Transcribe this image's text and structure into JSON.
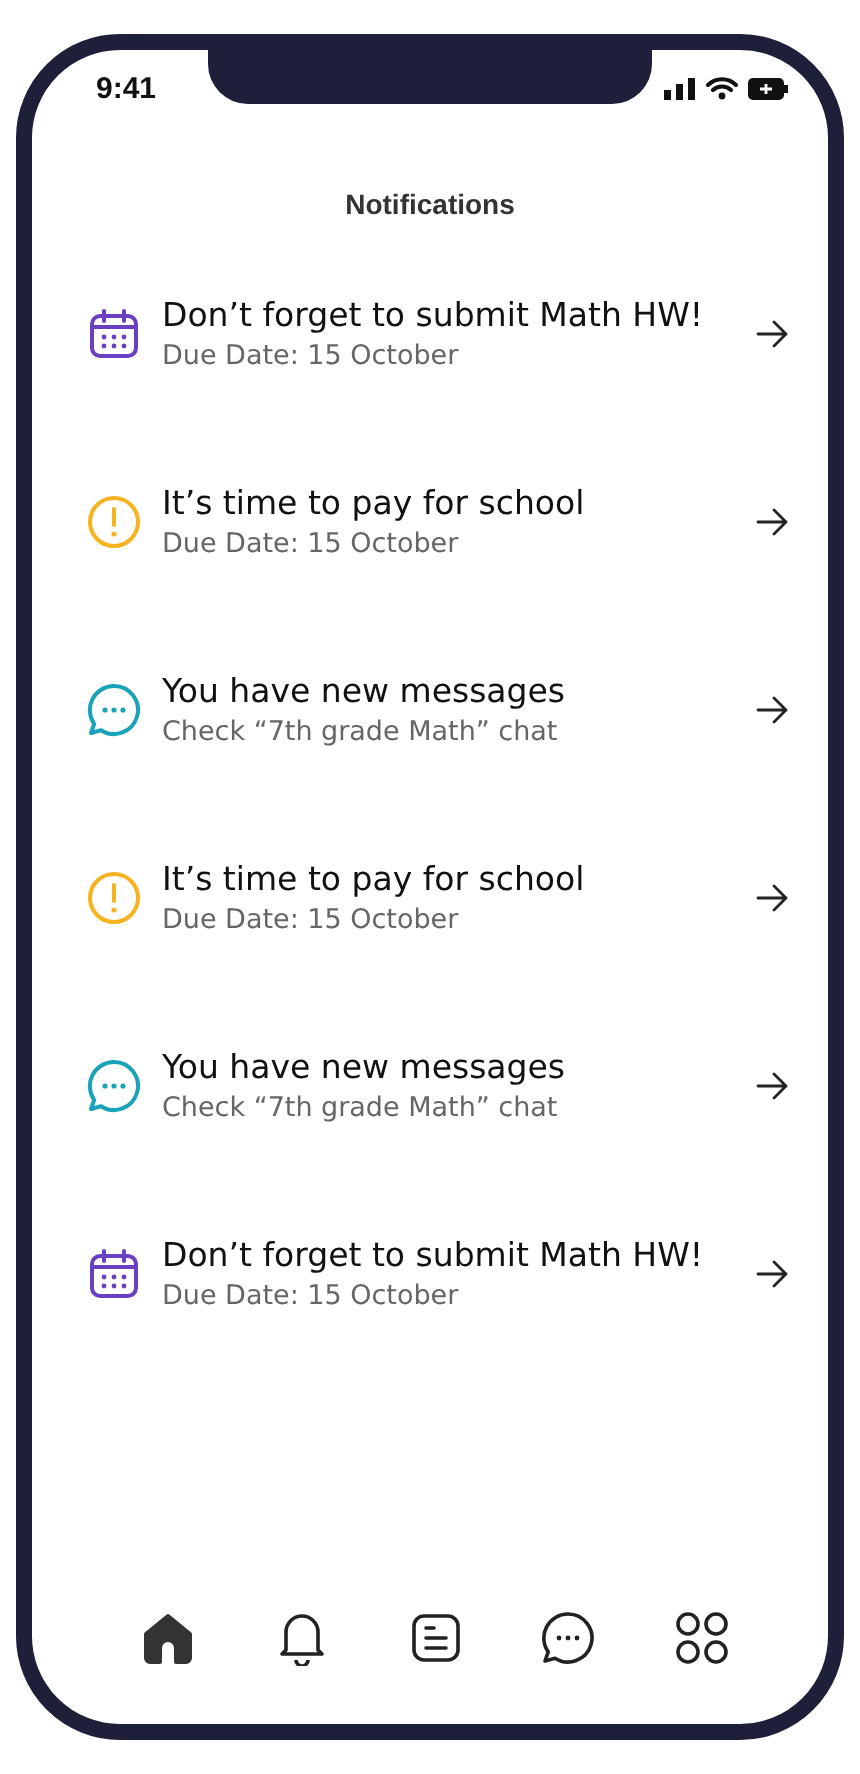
{
  "status_bar": {
    "time": "9:41"
  },
  "header": {
    "title": "Notifications"
  },
  "notifications": [
    {
      "kind": "calendar",
      "color": "#6a3fc1",
      "title": "Don’t forget to submit Math HW!",
      "subtitle": "Due Date: 15 October"
    },
    {
      "kind": "alert",
      "color": "#f5b320",
      "title": "It’s time to pay for school",
      "subtitle": "Due Date: 15 October"
    },
    {
      "kind": "chat",
      "color": "#1aa3b8",
      "title": "You have new messages",
      "subtitle": "Check “7th grade Math” chat"
    },
    {
      "kind": "alert",
      "color": "#f5b320",
      "title": "It’s time to pay for school",
      "subtitle": "Due Date: 15 October"
    },
    {
      "kind": "chat",
      "color": "#1aa3b8",
      "title": "You have new messages",
      "subtitle": "Check “7th grade Math” chat"
    },
    {
      "kind": "calendar",
      "color": "#6a3fc1",
      "title": "Don’t forget to submit Math HW!",
      "subtitle": "Due Date: 15 October"
    }
  ],
  "tab_bar": [
    {
      "kind": "home",
      "selected": true
    },
    {
      "kind": "bell",
      "selected": false
    },
    {
      "kind": "document",
      "selected": false
    },
    {
      "kind": "chat",
      "selected": false
    },
    {
      "kind": "grid",
      "selected": false
    }
  ]
}
